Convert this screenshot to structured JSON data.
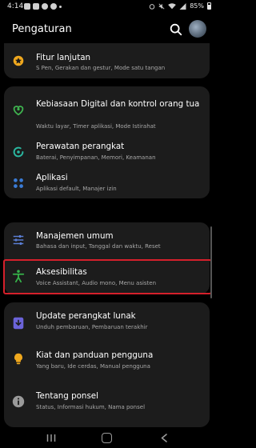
{
  "status_bar": {
    "time": "4:14",
    "battery": "85%"
  },
  "header": {
    "title": "Pengaturan"
  },
  "items": [
    {
      "title": "Fitur lanjutan",
      "subtitle": "S Pen, Gerakan dan gestur, Mode satu tangan",
      "icon": "star-gear-icon",
      "color": "#f0a81e"
    },
    {
      "title": "Kebiasaan Digital dan kontrol orang tua",
      "subtitle": "Waktu layar, Timer aplikasi, Mode Istirahat",
      "icon": "digital-wellbeing-icon",
      "color": "#3fb34f"
    },
    {
      "title": "Perawatan perangkat",
      "subtitle": "Baterai, Penyimpanan, Memori, Keamanan",
      "icon": "device-care-icon",
      "color": "#2ab7a0"
    },
    {
      "title": "Aplikasi",
      "subtitle": "Aplikasi default, Manajer izin",
      "icon": "apps-grid-icon",
      "color": "#3a7bd5"
    },
    {
      "title": "Manajemen umum",
      "subtitle": "Bahasa dan input, Tanggal dan waktu, Reset",
      "icon": "sliders-icon",
      "color": "#5b7fd6"
    },
    {
      "title": "Aksesibilitas",
      "subtitle": "Voice Assistant, Audio mono, Menu asisten",
      "icon": "accessibility-icon",
      "color": "#36b24a"
    },
    {
      "title": "Update perangkat lunak",
      "subtitle": "Unduh pembaruan, Pembaruan terakhir",
      "icon": "software-update-icon",
      "color": "#6b63d9"
    },
    {
      "title": "Kiat dan panduan pengguna",
      "subtitle": "Yang baru, Ide cerdas, Manual pengguna",
      "icon": "lightbulb-icon",
      "color": "#f0a81e"
    },
    {
      "title": "Tentang ponsel",
      "subtitle": "Status, Informasi hukum, Nama ponsel",
      "icon": "info-icon",
      "color": "#9a9a9a"
    }
  ]
}
